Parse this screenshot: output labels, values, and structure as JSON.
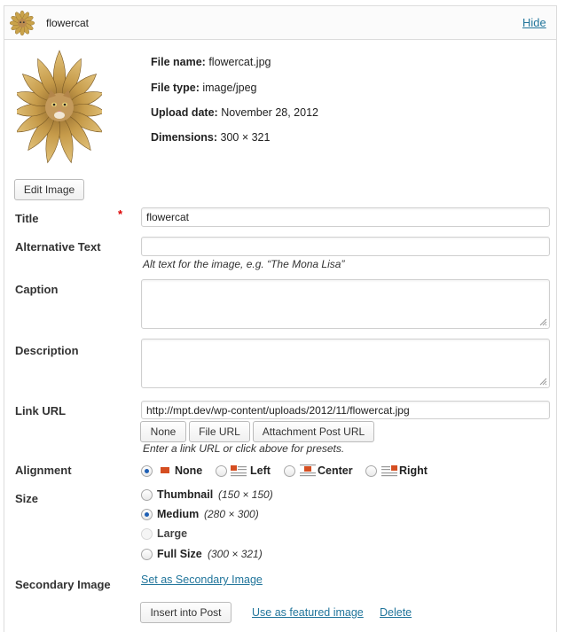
{
  "header": {
    "title": "flowercat",
    "hide_label": "Hide"
  },
  "file_info": {
    "name_label": "File name:",
    "name_value": "flowercat.jpg",
    "type_label": "File type:",
    "type_value": "image/jpeg",
    "upload_label": "Upload date:",
    "upload_value": "November 28, 2012",
    "dimensions_label": "Dimensions:",
    "dimensions_value": "300 × 321"
  },
  "edit_image_label": "Edit Image",
  "fields": {
    "title": {
      "label": "Title",
      "required_mark": "*",
      "value": "flowercat"
    },
    "alt": {
      "label": "Alternative Text",
      "value": "",
      "help": "Alt text for the image, e.g. “The Mona Lisa”"
    },
    "caption": {
      "label": "Caption",
      "value": ""
    },
    "description": {
      "label": "Description",
      "value": ""
    },
    "link_url": {
      "label": "Link URL",
      "value": "http://mpt.dev/wp-content/uploads/2012/11/flowercat.jpg",
      "buttons": [
        "None",
        "File URL",
        "Attachment Post URL"
      ],
      "help": "Enter a link URL or click above for presets."
    }
  },
  "alignment": {
    "label": "Alignment",
    "options": [
      "None",
      "Left",
      "Center",
      "Right"
    ],
    "selected": "None"
  },
  "size": {
    "label": "Size",
    "options": [
      {
        "name": "Thumbnail",
        "dims": "(150 × 150)"
      },
      {
        "name": "Medium",
        "dims": "(280 × 300)"
      },
      {
        "name": "Large",
        "dims": ""
      },
      {
        "name": "Full Size",
        "dims": "(300 × 321)"
      }
    ],
    "selected": "Medium"
  },
  "secondary_image": {
    "label": "Secondary Image",
    "link": "Set as Secondary Image"
  },
  "actions": {
    "insert_label": "Insert into Post",
    "featured_label": "Use as featured image",
    "delete_label": "Delete"
  },
  "colors": {
    "link": "#21759b",
    "required": "#dd0000",
    "radio_dot": "#1e5fb4",
    "align_icon": "#d54e21"
  },
  "icons": {
    "attachment": "flowercat-thumbnail",
    "resize": "resize-grip-icon",
    "align": "alignment-icon"
  }
}
